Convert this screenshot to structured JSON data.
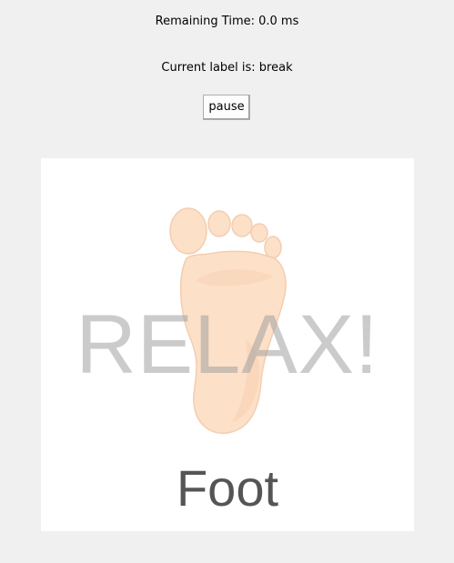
{
  "status": {
    "remaining_time": "Remaining Time: 0.0 ms",
    "current_label": "Current label is: break"
  },
  "controls": {
    "pause_label": "pause"
  },
  "stimulus": {
    "overlay_text": "RELAX!",
    "caption": "Foot",
    "image_icon": "foot-sole-icon",
    "colors": {
      "skin": "#fde0c8",
      "overlay": "#a0a0a0",
      "caption": "#555555"
    }
  }
}
